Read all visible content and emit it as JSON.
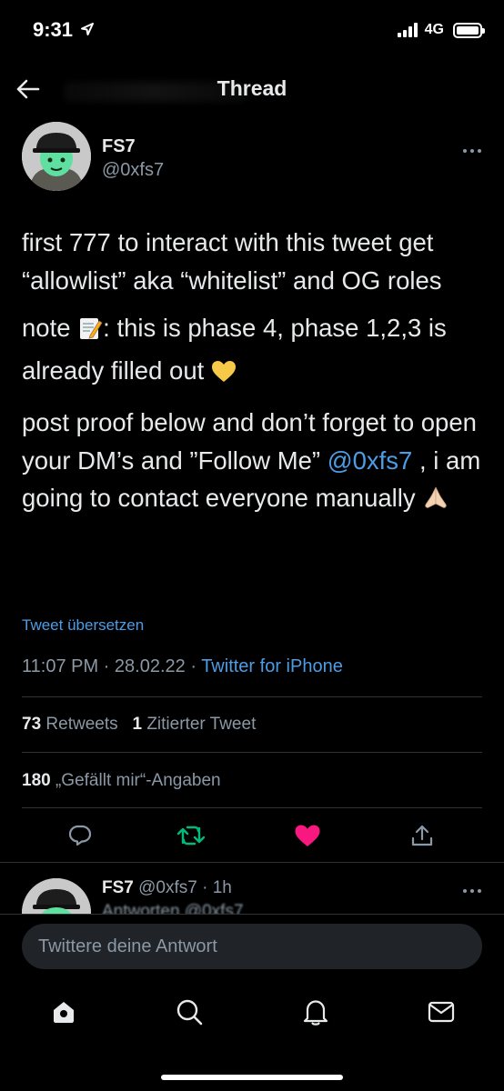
{
  "status_bar": {
    "time": "9:31",
    "network": "4G",
    "icons": [
      "location-arrow-icon",
      "signal-icon",
      "battery-icon"
    ]
  },
  "header": {
    "title": "Thread",
    "icons": [
      "back-arrow-icon"
    ]
  },
  "tweet": {
    "author_name": "FS7",
    "author_handle": "@0xfs7",
    "paragraph_1": "first 777 to interact with this tweet get “allowlist” aka “whitelist” and OG roles",
    "paragraph_2_before": "note ",
    "paragraph_2_after": ": this is phase 4, phase 1,2,3 is already filled out ",
    "paragraph_3_before": "post proof below and don’t forget to open your DM’s and ”Follow Me” ",
    "mention": "@0xfs7",
    "paragraph_3_after": " , i am going to contact everyone manually ",
    "translate_label": "Tweet übersetzen",
    "time": "11:07 PM",
    "date": "28.02.22",
    "separator": " · ",
    "source": "Twitter for iPhone",
    "retweets_count": "73",
    "retweets_label": "Retweets",
    "quotes_count": "1",
    "quotes_label": "Zitierter Tweet",
    "likes_count": "180",
    "likes_label": "„Gefällt mir“-Angaben",
    "liked": true
  },
  "reply": {
    "author_name": "FS7",
    "author_handle": "@0xfs7",
    "age": "· 1h",
    "snippet": "Antworten @0xfs7"
  },
  "compose": {
    "placeholder": "Twittere deine Antwort"
  },
  "tabbar": {
    "items": [
      "home-icon",
      "search-icon",
      "notifications-icon",
      "messages-icon"
    ]
  },
  "colors": {
    "background": "#000000",
    "text": "#e7e9ea",
    "secondary": "#8b98a5",
    "link": "#4d9ce6",
    "retweet": "#00ba7c",
    "like": "#f91880"
  }
}
